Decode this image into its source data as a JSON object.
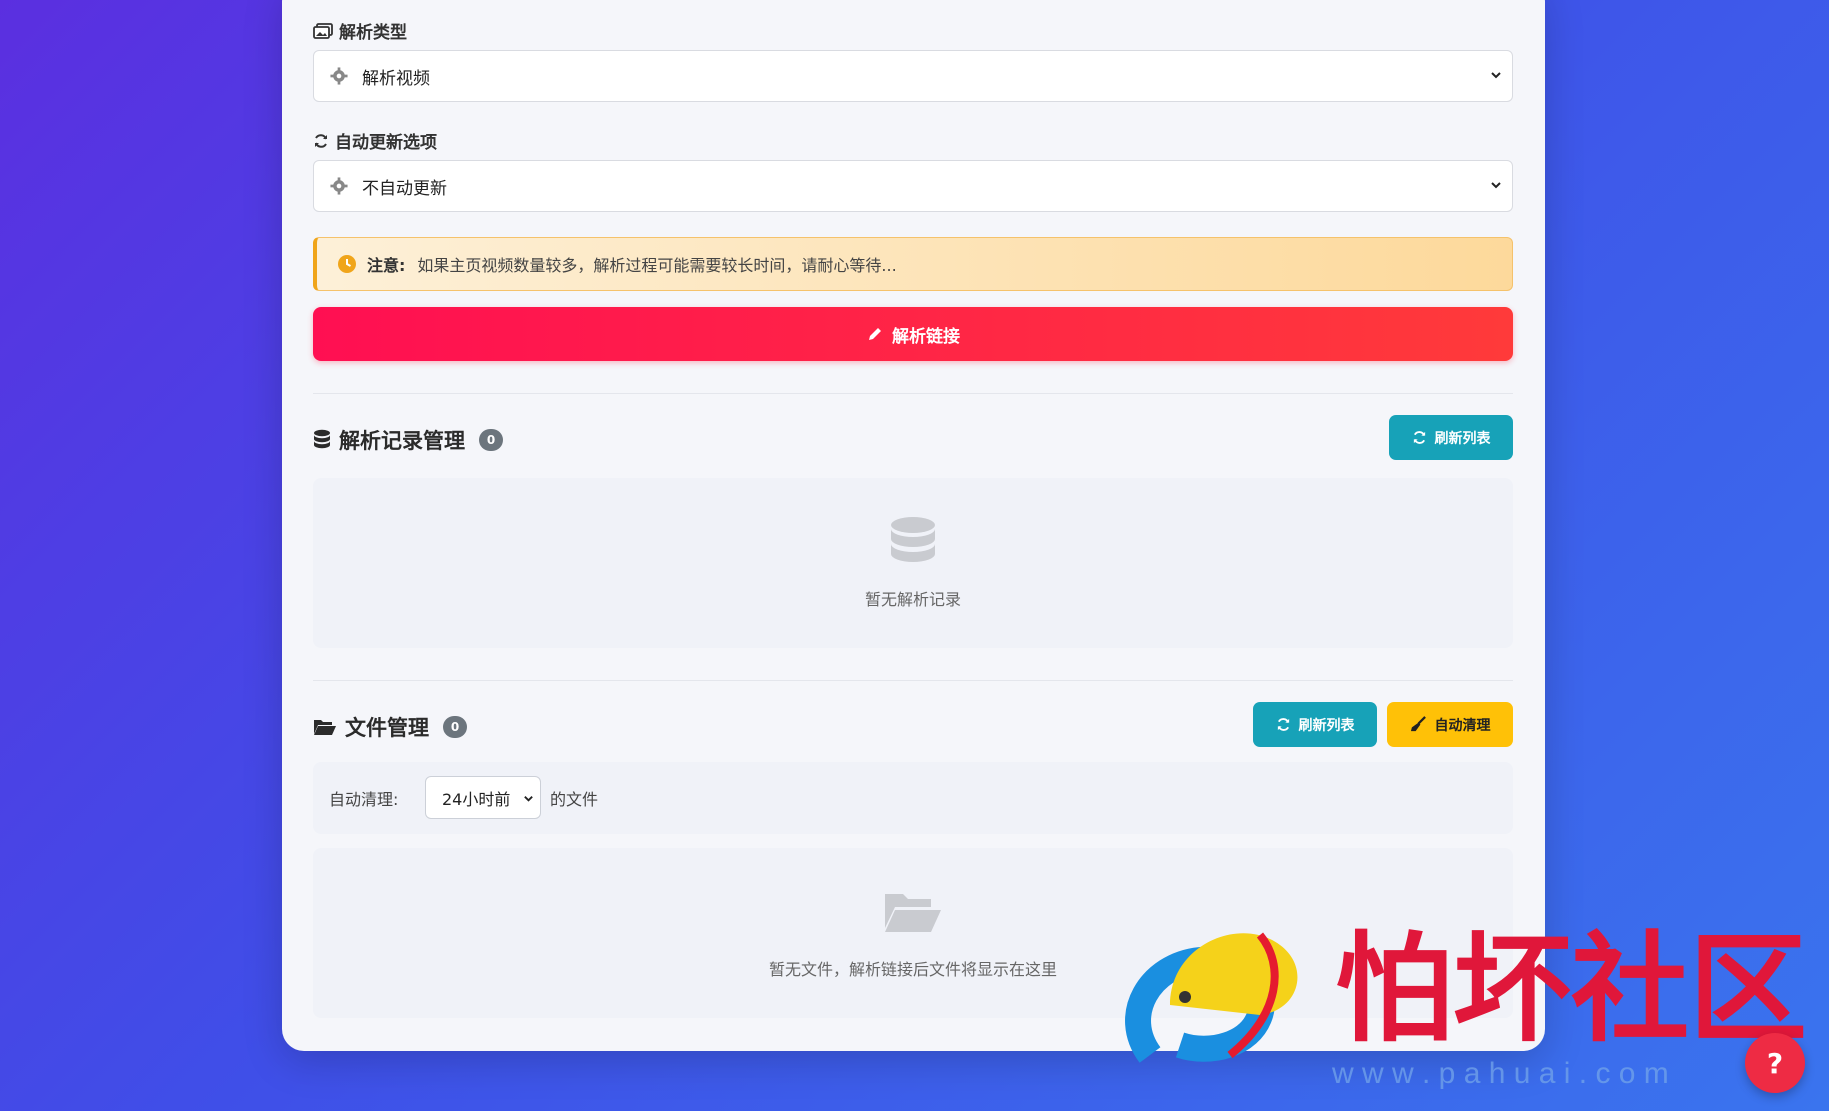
{
  "parse_type": {
    "label": "解析类型",
    "selected": "解析视频"
  },
  "auto_update": {
    "label": "自动更新选项",
    "selected": "不自动更新"
  },
  "notice": {
    "title": "注意:",
    "text": "如果主页视频数量较多，解析过程可能需要较长时间，请耐心等待..."
  },
  "parse_button": {
    "label": "解析链接"
  },
  "records": {
    "title": "解析记录管理",
    "count": "0",
    "refresh_label": "刷新列表",
    "empty_text": "暂无解析记录"
  },
  "files": {
    "title": "文件管理",
    "count": "0",
    "refresh_label": "刷新列表",
    "auto_clean_label": "自动清理",
    "auto_clean_prefix": "自动清理:",
    "auto_clean_selected": "24小时前",
    "auto_clean_suffix": "的文件",
    "empty_text": "暂无文件，解析链接后文件将显示在这里"
  },
  "watermark": {
    "brand": "怕坏社区",
    "url": "w w w . p a h u a i . c o m"
  },
  "help": {
    "label": "?"
  },
  "colors": {
    "primary_red": "#ff1a4b",
    "info": "#17a2b8",
    "warning": "#ffc107"
  }
}
